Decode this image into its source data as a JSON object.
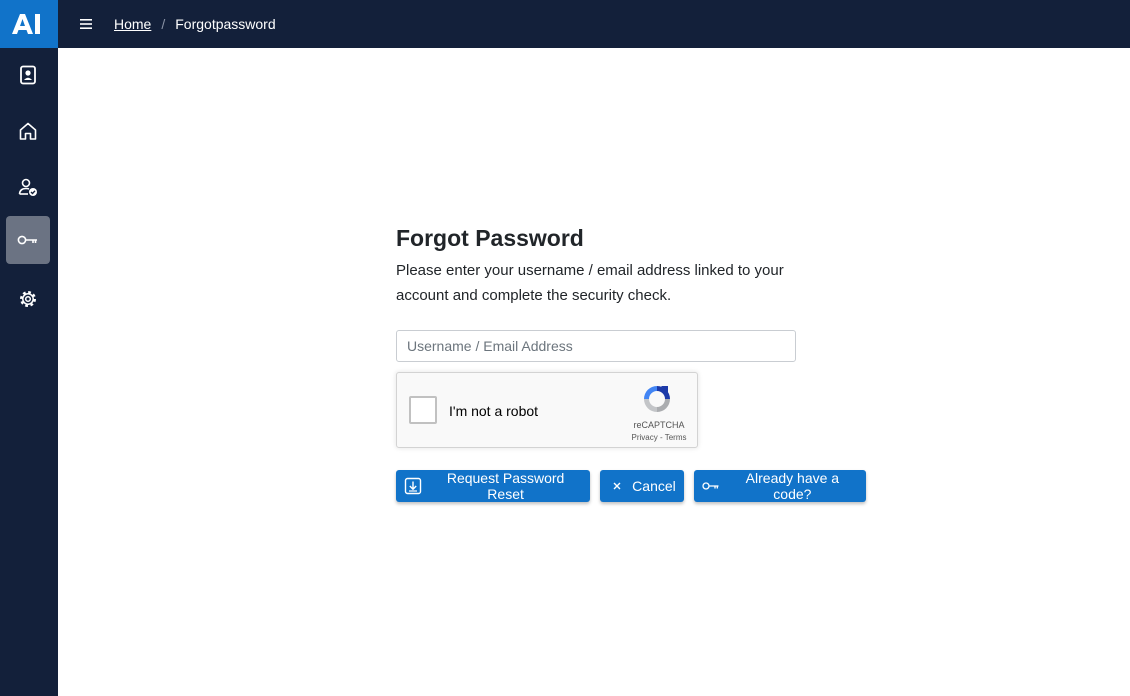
{
  "header": {
    "logo": "AI",
    "menu_icon": "hamburger-icon",
    "breadcrumb": {
      "home": "Home",
      "separator": "/",
      "current": "Forgotpassword"
    }
  },
  "sidebar": {
    "items": [
      {
        "name": "badge-icon",
        "active": false
      },
      {
        "name": "home-icon",
        "active": false
      },
      {
        "name": "user-check-icon",
        "active": false
      },
      {
        "name": "key-icon",
        "active": true
      },
      {
        "name": "gear-icon",
        "active": false
      }
    ]
  },
  "form": {
    "title": "Forgot Password",
    "description": "Please enter your username / email address linked to your account and complete the security check.",
    "username_placeholder": "Username / Email Address",
    "captcha": {
      "label": "I'm not a robot",
      "brand": "reCAPTCHA",
      "links": "Privacy - Terms"
    },
    "buttons": {
      "request": "Request Password Reset",
      "cancel": "Cancel",
      "have_code": "Already have a code?"
    }
  },
  "colors": {
    "navy": "#13203a",
    "accent": "#1173c9",
    "active_item": "#6b7383"
  }
}
